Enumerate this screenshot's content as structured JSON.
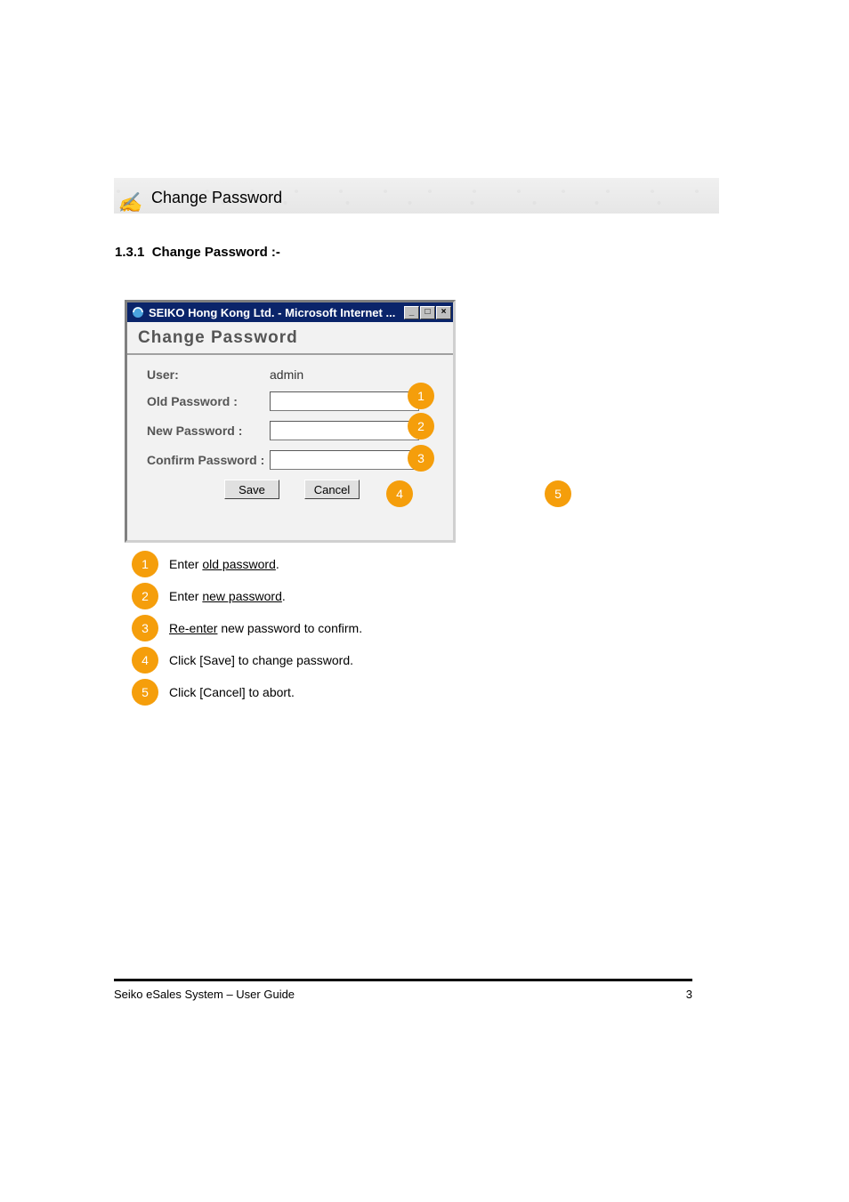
{
  "heading": {
    "label": "Change Password"
  },
  "section": {
    "number": "1.3.1",
    "title": "Change Password :-"
  },
  "window": {
    "title": "SEIKO Hong Kong Ltd. - Microsoft Internet ...",
    "dialog_title": "Change Password",
    "user_label": "User:",
    "user_value": "admin",
    "old_pw_label": "Old Password :",
    "new_pw_label": "New Password :",
    "confirm_pw_label": "Confirm Password :",
    "save_label": "Save",
    "cancel_label": "Cancel"
  },
  "markers": {
    "m1": "1",
    "m2": "2",
    "m3": "3",
    "m4": "4",
    "m5": "5"
  },
  "legend": [
    {
      "num": "1",
      "before": "Enter ",
      "u": "old password",
      "after": "."
    },
    {
      "num": "2",
      "before": "Enter ",
      "u": "new password",
      "after": "."
    },
    {
      "num": "3",
      "before": "",
      "u": "Re-enter",
      "after": " new password to confirm."
    },
    {
      "num": "4",
      "before": "Click [Save] to change password.",
      "u": "",
      "after": ""
    },
    {
      "num": "5",
      "before": "Click [Cancel] to abort.",
      "u": "",
      "after": ""
    }
  ],
  "footer": {
    "left": "Seiko eSales System – User Guide",
    "right": "3"
  }
}
